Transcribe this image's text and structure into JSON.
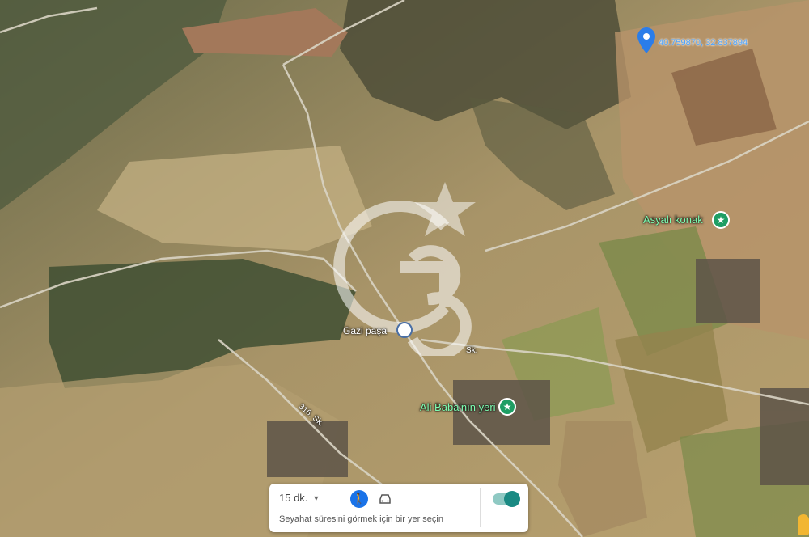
{
  "map": {
    "pin_coords": "40.759870, 32.837894",
    "places": {
      "asyali_konak": "Asyalı konak",
      "gazi_pasa": "Gazi paşa",
      "ali_baba": "Ali Baba'nın yeri"
    },
    "road_label": "316. Sk.",
    "minor_label": "Sk."
  },
  "watermark": {
    "text": "G3"
  },
  "travel_panel": {
    "duration_value": "15 dk.",
    "hint": "Seyahat süresini görmek için bir yer seçin",
    "modes": [
      "walk-icon",
      "car-icon"
    ],
    "toggle_on": true
  },
  "colors": {
    "pin": "#2b7de9",
    "poi_green": "#1e9e64",
    "toggle": "#1a8a83"
  }
}
